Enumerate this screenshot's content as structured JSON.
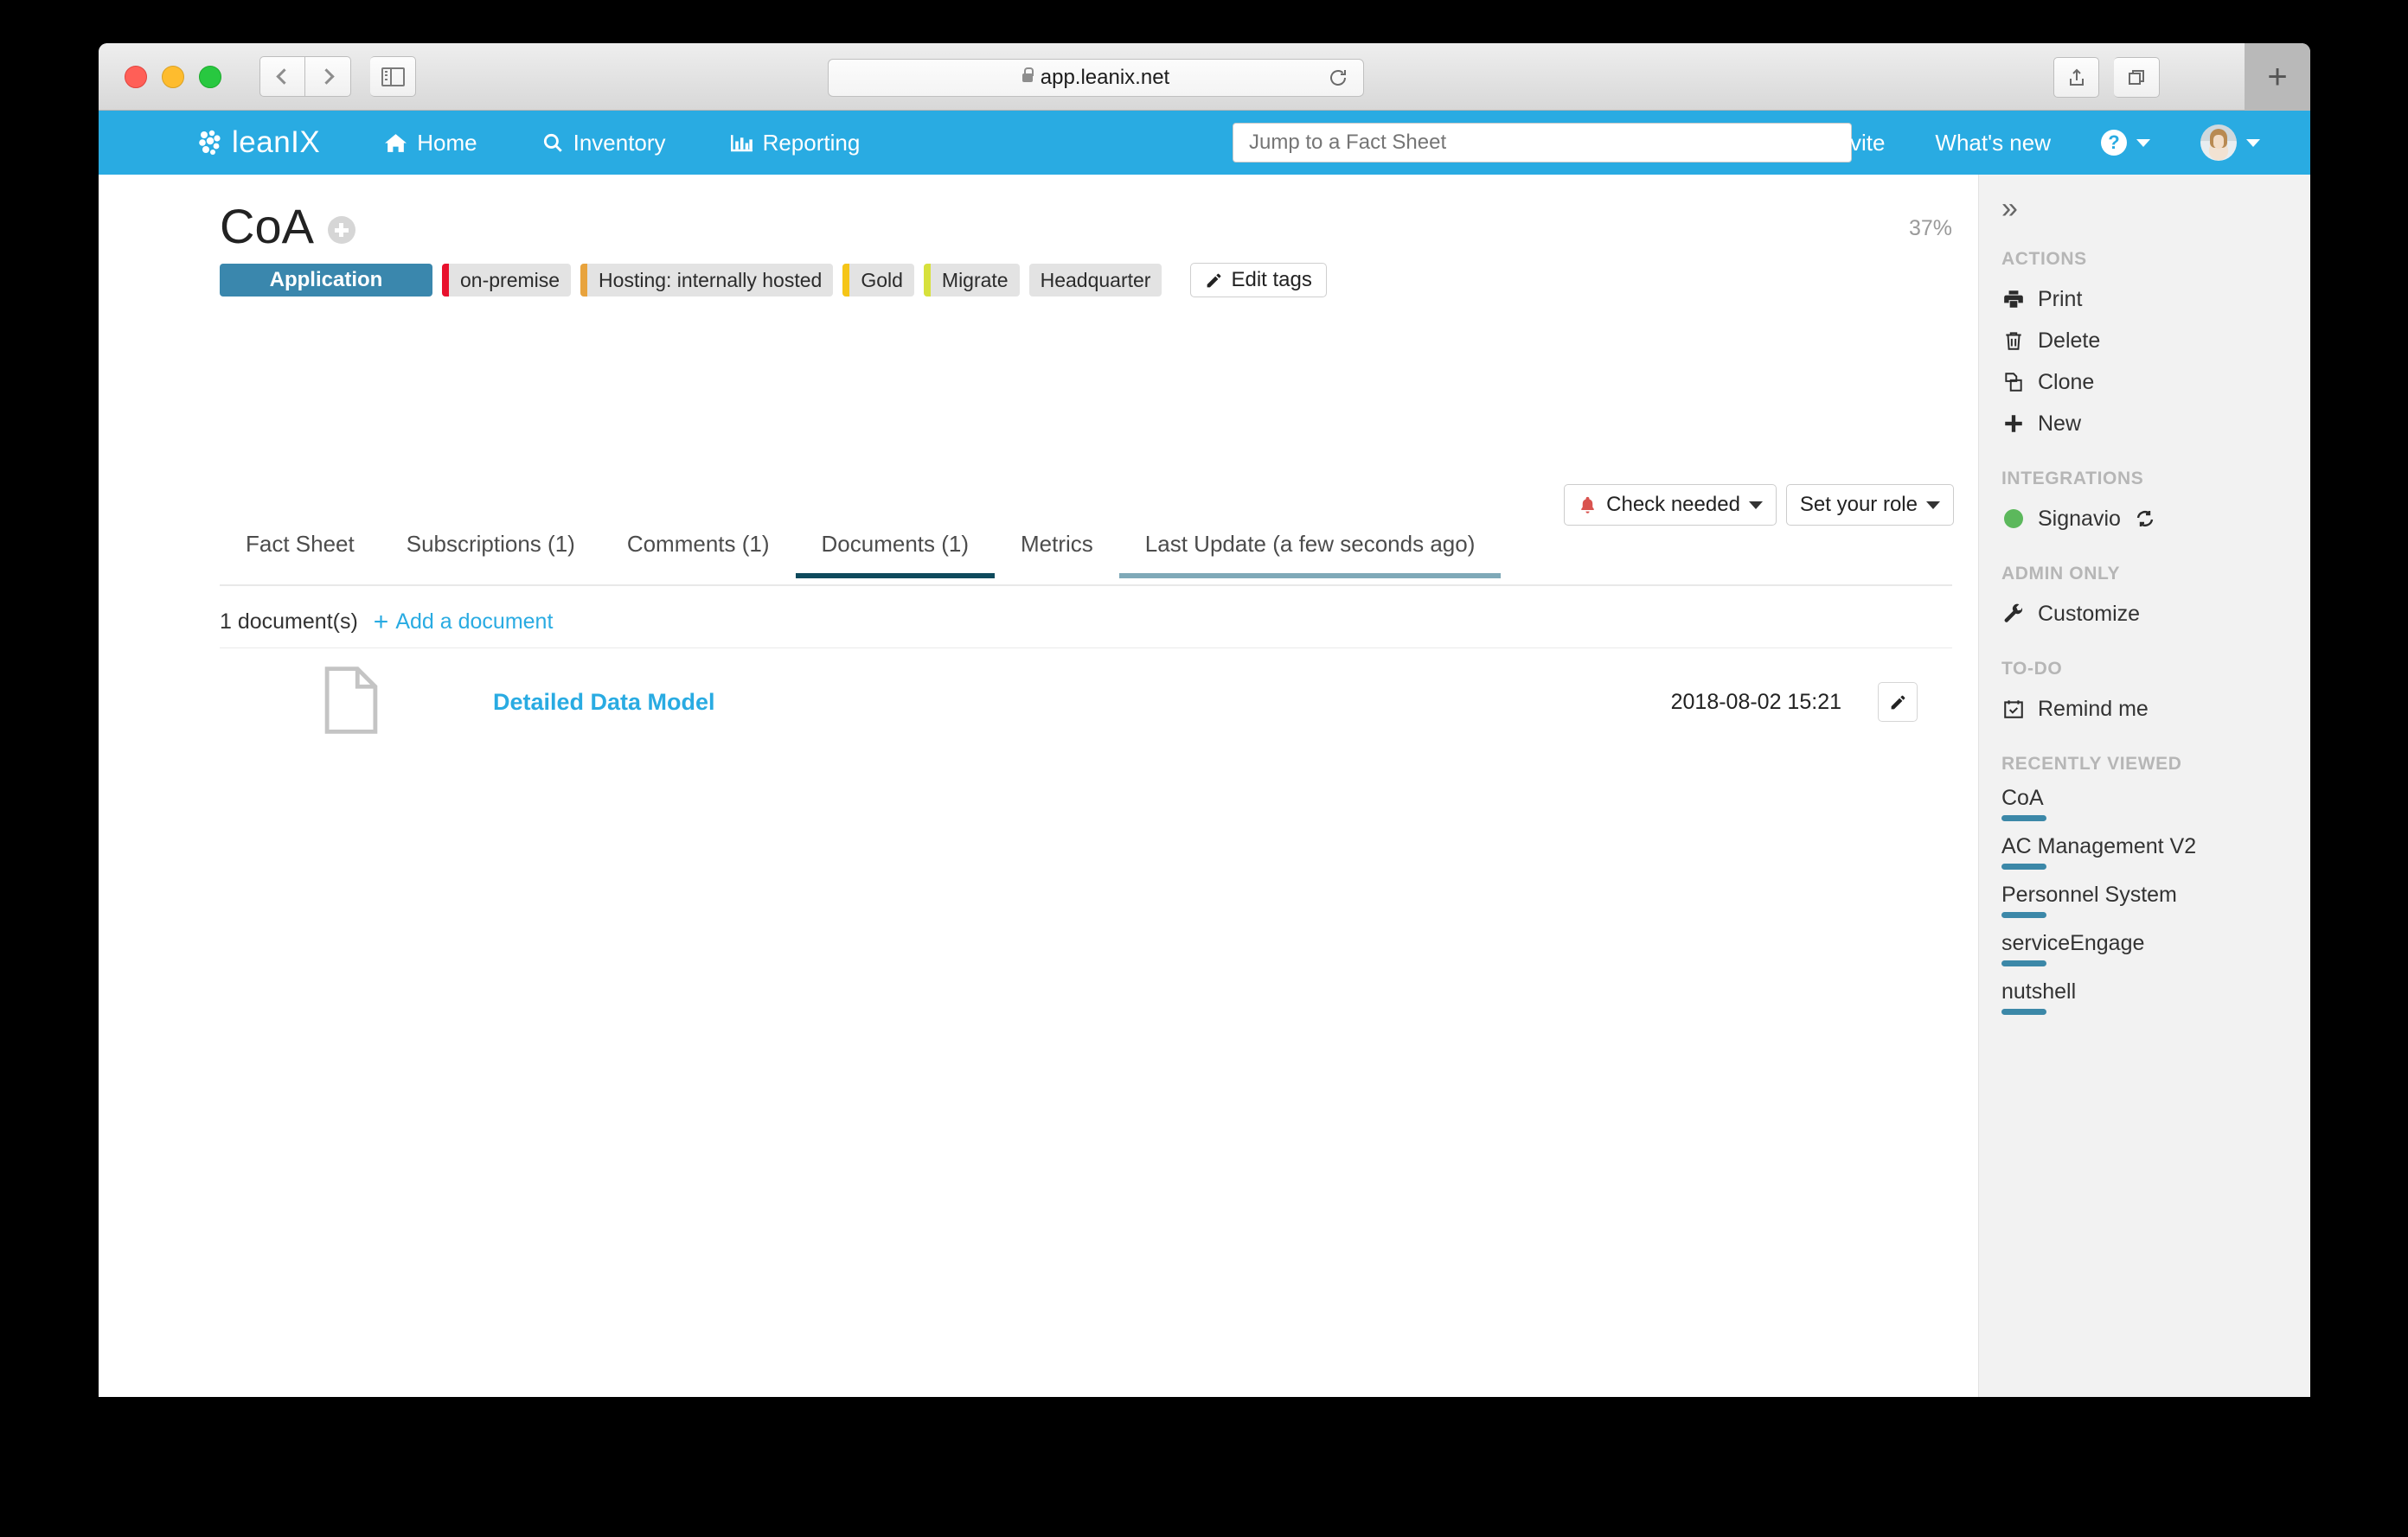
{
  "browser": {
    "url": "app.leanix.net",
    "back_label": "Back",
    "forward_label": "Forward",
    "sidebar_label": "Show Sidebar",
    "share_label": "Share",
    "tabs_label": "Show Tab Overview",
    "newtab_label": "+"
  },
  "topnav": {
    "logo_text": "leanIX",
    "items": [
      {
        "label": "Home",
        "icon": "home-icon"
      },
      {
        "label": "Inventory",
        "icon": "search-icon"
      },
      {
        "label": "Reporting",
        "icon": "bar-chart-icon"
      }
    ],
    "search_placeholder": "Jump to a Fact Sheet",
    "invite_label": "Invite",
    "whats_new_label": "What's new",
    "help_icon": "question-mark-icon"
  },
  "factsheet": {
    "title": "CoA",
    "completeness": "37%",
    "type_badge": "Application",
    "tags": [
      {
        "label": "on-premise",
        "color": "#e8112d"
      },
      {
        "label": "Hosting: internally hosted",
        "color": "#e8a33d"
      },
      {
        "label": "Gold",
        "color": "#f5c518"
      },
      {
        "label": "Migrate",
        "color": "#d7e13c"
      },
      {
        "label": "Headquarter",
        "color": ""
      }
    ],
    "edit_tags_label": "Edit tags",
    "check_needed_label": "Check needed",
    "set_role_label": "Set your role",
    "tabs": [
      {
        "label": "Fact Sheet",
        "state": ""
      },
      {
        "label": "Subscriptions (1)",
        "state": ""
      },
      {
        "label": "Comments (1)",
        "state": ""
      },
      {
        "label": "Documents (1)",
        "state": "active"
      },
      {
        "label": "Metrics",
        "state": ""
      },
      {
        "label": "Last Update (a few seconds ago)",
        "state": "softactive"
      }
    ]
  },
  "documents": {
    "count_label": "1 document(s)",
    "add_label": "Add a document",
    "rows": [
      {
        "name": "Detailed Data Model",
        "date": "2018-08-02 15:21"
      }
    ]
  },
  "sidebar": {
    "collapse_icon": "»",
    "sections": [
      {
        "title": "ACTIONS",
        "items": [
          {
            "label": "Print",
            "icon": "printer-icon"
          },
          {
            "label": "Delete",
            "icon": "trash-icon"
          },
          {
            "label": "Clone",
            "icon": "copy-icon"
          },
          {
            "label": "New",
            "icon": "plus-icon"
          }
        ]
      },
      {
        "title": "INTEGRATIONS",
        "items": [
          {
            "label": "Signavio",
            "icon": "status-dot-icon",
            "status_color": "#5cb85c",
            "trailing_icon": "refresh-icon"
          }
        ]
      },
      {
        "title": "ADMIN ONLY",
        "items": [
          {
            "label": "Customize",
            "icon": "wrench-icon"
          }
        ]
      },
      {
        "title": "TO-DO",
        "items": [
          {
            "label": "Remind me",
            "icon": "calendar-check-icon"
          }
        ]
      }
    ],
    "recently_viewed_title": "RECENTLY VIEWED",
    "recently_viewed": [
      {
        "label": "CoA"
      },
      {
        "label": "AC Management V2"
      },
      {
        "label": "Personnel System"
      },
      {
        "label": "serviceEngage"
      },
      {
        "label": "nutshell"
      }
    ]
  },
  "colors": {
    "brand_blue": "#29abe2",
    "badge_blue": "#3a87ad",
    "active_tab": "#0e4a5c",
    "soft_tab": "#7fa9b8",
    "link_blue": "#29abe2",
    "green": "#5cb85c",
    "bell_red": "#d9534f"
  }
}
